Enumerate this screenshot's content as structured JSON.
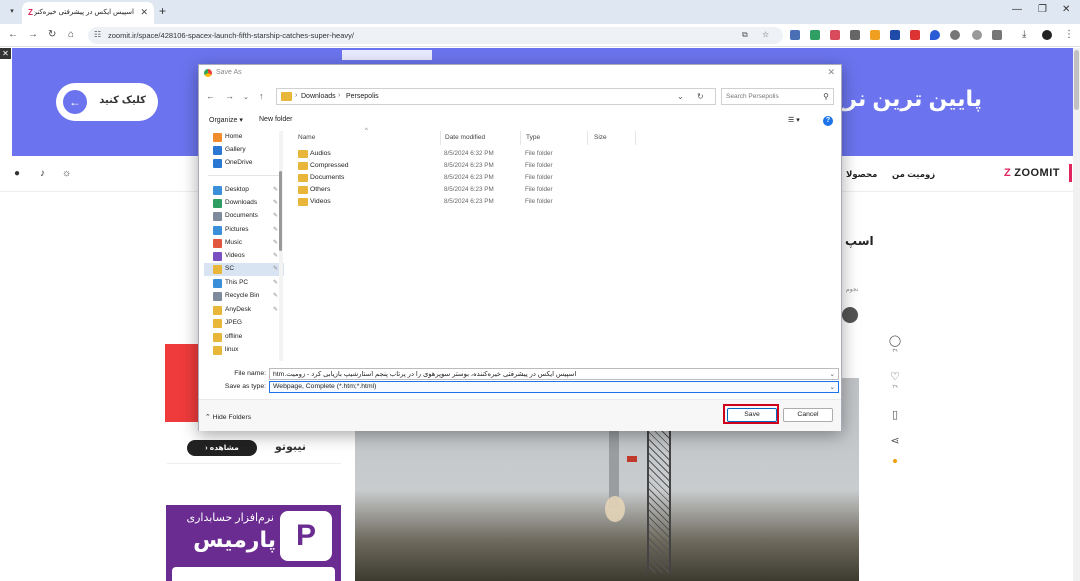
{
  "browser": {
    "tab_title": "اسپیس ایکس در پیشرفتی خیره‌کنن",
    "tab_favicon": "Z",
    "url": "zoomit.ir/space/428106-spacex-launch-fifth-starship-catches-super-heavy/"
  },
  "page": {
    "banner_button_label": "کلیک کنید",
    "banner_headline": "پایین ترین نرخ",
    "nav_logo": "ZOOMIT",
    "nav_link_1": "زومیت من",
    "nav_link_2": "محصولا",
    "article_title_fragment": "اسپ",
    "meta_fragment": "نجوم",
    "likes_count": "۲۹",
    "comments_count": "۳۹",
    "ad_card_button": "مشاهده",
    "ad_card_brand": "نیبوتو",
    "ad_purple_line1": "نرم‌افزار حسابداری",
    "ad_purple_line2": "پارمیس"
  },
  "dialog": {
    "title": "Save As",
    "breadcrumb": [
      "Downloads",
      "Persepolis"
    ],
    "search_placeholder": "Search Persepolis",
    "organize_label": "Organize ▾",
    "new_folder_label": "New folder",
    "nav_items": [
      {
        "label": "Home",
        "color": "#f08c2c"
      },
      {
        "label": "Gallery",
        "color": "#2b78d4"
      },
      {
        "label": "OneDrive",
        "color": "#2b78d4"
      },
      {
        "label": "Desktop",
        "color": "#3b8fd9"
      },
      {
        "label": "Downloads",
        "color": "#2f9e63"
      },
      {
        "label": "Documents",
        "color": "#7d8b9c"
      },
      {
        "label": "Pictures",
        "color": "#3b8fd9"
      },
      {
        "label": "Music",
        "color": "#e2553e"
      },
      {
        "label": "Videos",
        "color": "#7a4fc2"
      },
      {
        "label": "SC",
        "color": "#e8b73a"
      },
      {
        "label": "This PC",
        "color": "#3b8fd9"
      },
      {
        "label": "Recycle Bin",
        "color": "#7d8b9c"
      },
      {
        "label": "AnyDesk",
        "color": "#e8b73a"
      },
      {
        "label": "JPEG",
        "color": "#e8b73a"
      },
      {
        "label": "offline",
        "color": "#e8b73a"
      },
      {
        "label": "linux",
        "color": "#e8b73a"
      }
    ],
    "columns": [
      "Name",
      "Date modified",
      "Type",
      "Size"
    ],
    "files": [
      {
        "name": "Audios",
        "date": "8/5/2024 6:32 PM",
        "type": "File folder"
      },
      {
        "name": "Compressed",
        "date": "8/5/2024 6:23 PM",
        "type": "File folder"
      },
      {
        "name": "Documents",
        "date": "8/5/2024 6:23 PM",
        "type": "File folder"
      },
      {
        "name": "Others",
        "date": "8/5/2024 6:23 PM",
        "type": "File folder"
      },
      {
        "name": "Videos",
        "date": "8/5/2024 6:23 PM",
        "type": "File folder"
      }
    ],
    "file_name_label": "File name:",
    "file_name_value": "اسپیس ایکس در پیشرفتی خیره‌کننده، بوستر سوپرهوی را در پرتاب پنجم استارشیپ بازیابی کرد - زومیت.htm",
    "save_type_label": "Save as type:",
    "save_type_value": "Webpage, Complete (*.htm;*.html)",
    "hide_folders_label": "Hide Folders",
    "save_label": "Save",
    "cancel_label": "Cancel"
  }
}
